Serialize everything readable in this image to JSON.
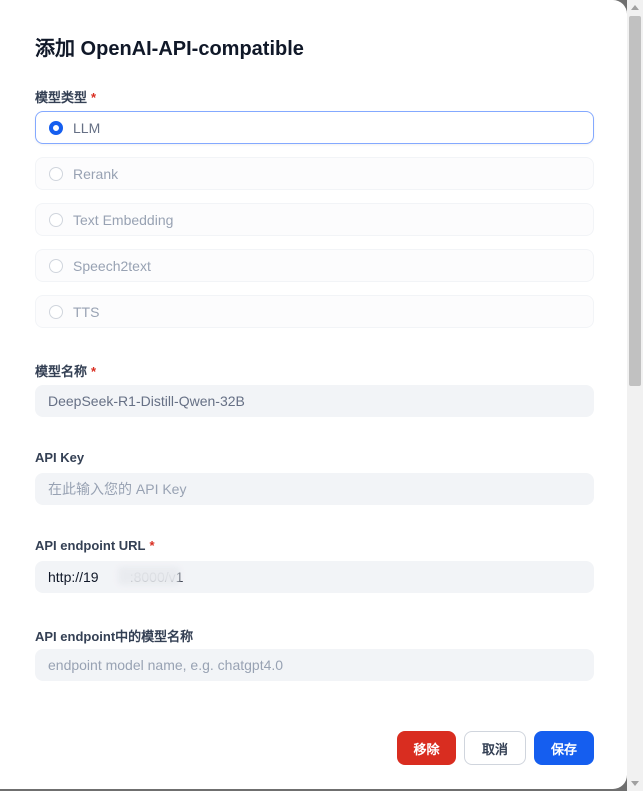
{
  "modal": {
    "title": "添加 OpenAI-API-compatible"
  },
  "model_type": {
    "label": "模型类型",
    "required_mark": "*",
    "options": [
      {
        "label": "LLM",
        "selected": true
      },
      {
        "label": "Rerank",
        "selected": false
      },
      {
        "label": "Text Embedding",
        "selected": false
      },
      {
        "label": "Speech2text",
        "selected": false
      },
      {
        "label": "TTS",
        "selected": false
      }
    ]
  },
  "model_name": {
    "label": "模型名称",
    "required_mark": "*",
    "value": "DeepSeek-R1-Distill-Qwen-32B"
  },
  "api_key": {
    "label": "API Key",
    "placeholder": "在此输入您的 API Key",
    "value": ""
  },
  "endpoint_url": {
    "label": "API endpoint URL",
    "required_mark": "*",
    "value": "http://19        :8000/v1"
  },
  "endpoint_model_name": {
    "label": "API endpoint中的模型名称",
    "placeholder": "endpoint model name, e.g. chatgpt4.0",
    "value": ""
  },
  "footer": {
    "remove_label": "移除",
    "cancel_label": "取消",
    "save_label": "保存"
  },
  "colors": {
    "accent": "#155eef",
    "danger": "#d92d20",
    "field_bg": "#f2f4f7"
  }
}
